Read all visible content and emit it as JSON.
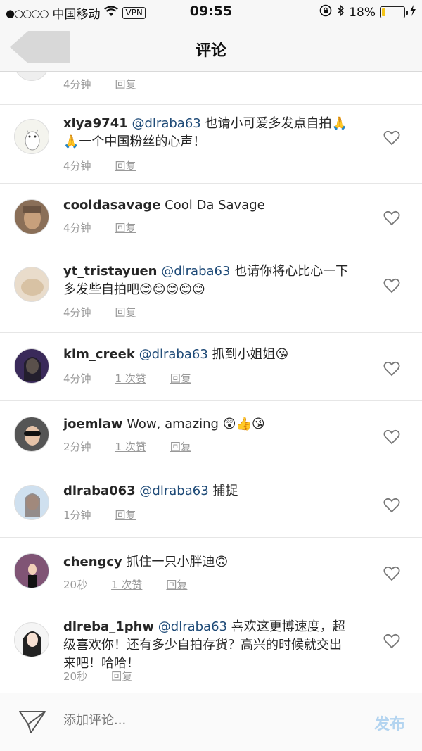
{
  "status_bar": {
    "signal": "●○○○○",
    "carrier": "中国移动",
    "wifi_icon": "wifi-icon",
    "vpn": "VPN",
    "time": "09:55",
    "battery_percent": "18%",
    "battery_level": 0.18
  },
  "nav": {
    "title": "评论",
    "back_icon": "back-arrow-icon"
  },
  "top_partial": {
    "time": "4分钟",
    "reply": "回复"
  },
  "comments": [
    {
      "user": "xiya9741",
      "mention": "@dlraba63",
      "text": "也请小可爱多发点自拍🙏🙏一个中国粉丝的心声！",
      "time": "4分钟",
      "likes": "",
      "reply": "回复"
    },
    {
      "user": "cooldasavage",
      "mention": "",
      "text": "Cool Da Savage",
      "time": "4分钟",
      "likes": "",
      "reply": "回复"
    },
    {
      "user": "yt_tristayuen",
      "mention": "@dlraba63",
      "text": "也请你将心比心一下多发些自拍吧😊😊😊😊😊",
      "time": "4分钟",
      "likes": "",
      "reply": "回复"
    },
    {
      "user": "kim_creek",
      "mention": "@dlraba63",
      "text": "抓到小姐姐😘",
      "time": "4分钟",
      "likes": "1 次赞",
      "reply": "回复"
    },
    {
      "user": "joemlaw",
      "mention": "",
      "text": "Wow, amazing 😲👍😘",
      "time": "2分钟",
      "likes": "1 次赞",
      "reply": "回复"
    },
    {
      "user": "dlraba063",
      "mention": "@dlraba63",
      "text": "捕捉",
      "time": "1分钟",
      "likes": "",
      "reply": "回复"
    },
    {
      "user": "chengcy",
      "mention": "",
      "text": "抓住一只小胖迪🙃",
      "time": "20秒",
      "likes": "1 次赞",
      "reply": "回复"
    },
    {
      "user": "dlreba_1phw",
      "mention": "@dlraba63",
      "text": "喜欢这更博速度，超级喜欢你！还有多少自拍存货？高兴的时候就交出来吧！哈哈！",
      "time": "20秒",
      "likes": "",
      "reply": "回复"
    }
  ],
  "composer": {
    "placeholder": "添加评论...",
    "post_label": "发布",
    "send_icon": "paper-plane-icon"
  },
  "colors": {
    "mention": "#1e4a77",
    "post_disabled": "#b3d4f0",
    "meta": "#999999"
  }
}
